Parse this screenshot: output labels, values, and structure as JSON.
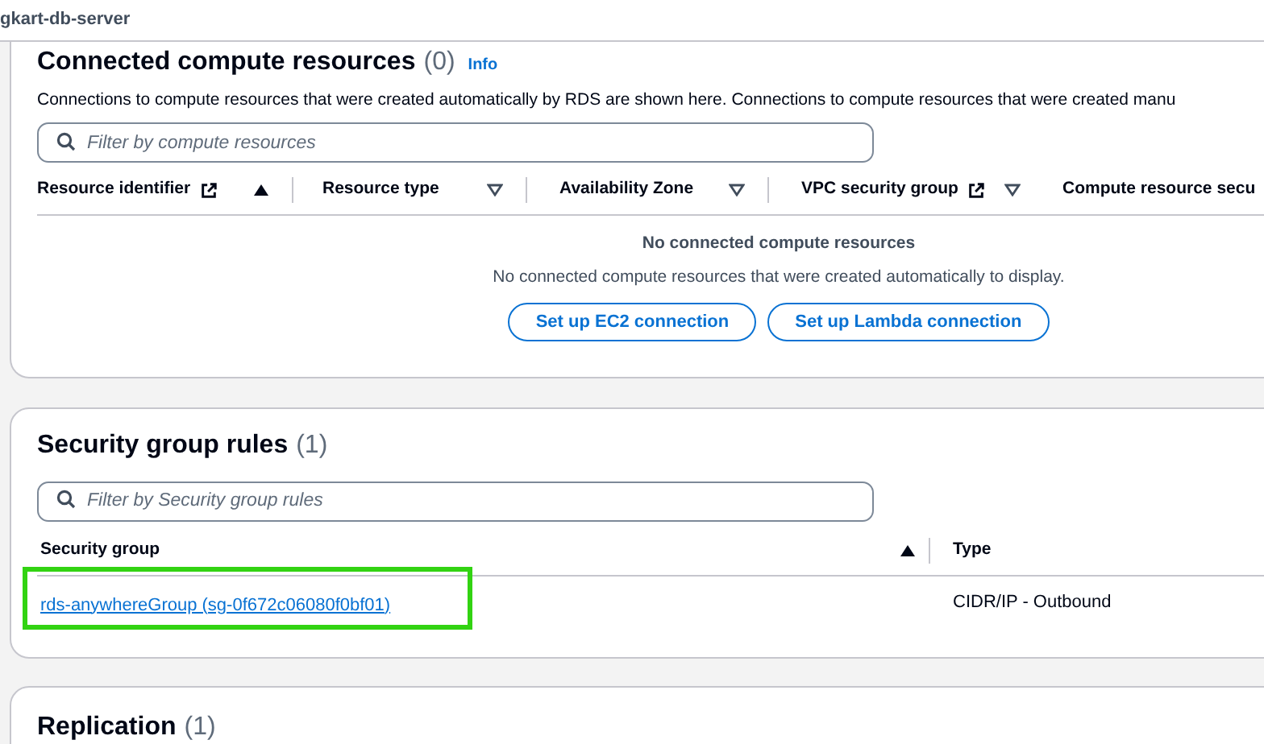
{
  "breadcrumb": "gkart-db-server",
  "compute": {
    "title": "Connected compute resources",
    "count": "(0)",
    "info": "Info",
    "description": "Connections to compute resources that were created automatically by RDS are shown here. Connections to compute resources that were created manu",
    "filter": {
      "placeholder": "Filter by compute resources"
    },
    "columns": [
      {
        "label": "Resource identifier",
        "external_link": true,
        "sorted": true
      },
      {
        "label": "Resource type",
        "external_link": false,
        "sorted": false
      },
      {
        "label": "Availability Zone",
        "external_link": false,
        "sorted": false
      },
      {
        "label": "VPC security group",
        "external_link": true,
        "sorted": false
      },
      {
        "label": "Compute resource secu",
        "external_link": false
      }
    ],
    "empty_title": "No connected compute resources",
    "empty_text": "No connected compute resources that were created automatically to display.",
    "buttons": [
      "Set up EC2 connection",
      "Set up Lambda connection"
    ]
  },
  "security_rules": {
    "title": "Security group rules",
    "count": "(1)",
    "filter": {
      "placeholder": "Filter by Security group rules"
    },
    "columns": [
      {
        "label": "Security group",
        "sorted": true
      },
      {
        "label": "Type"
      }
    ],
    "rows": [
      {
        "security_group": "rds-anywhereGroup (sg-0f672c06080f0bf01)",
        "type": "CIDR/IP - Outbound",
        "highlighted": true
      }
    ]
  },
  "replication": {
    "title": "Replication",
    "count": "(1)"
  }
}
